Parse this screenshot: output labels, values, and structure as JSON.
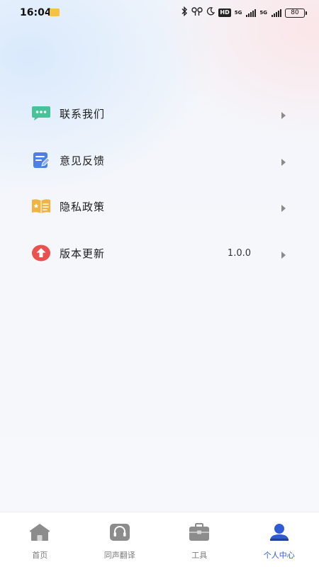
{
  "status_bar": {
    "time": "16:04",
    "hd": "HD",
    "network_1": "5G",
    "network_2": "5G",
    "battery": "80"
  },
  "menu": {
    "items": [
      {
        "label": "联系我们",
        "value": "",
        "icon": "chat-bubble-icon",
        "color": "#47c39a"
      },
      {
        "label": "意见反馈",
        "value": "",
        "icon": "feedback-edit-icon",
        "color": "#4f7fe6"
      },
      {
        "label": "隐私政策",
        "value": "",
        "icon": "privacy-book-icon",
        "color": "#f1b441"
      },
      {
        "label": "版本更新",
        "value": "1.0.0",
        "icon": "upgrade-arrow-icon",
        "color": "#e9524e"
      }
    ]
  },
  "tabbar": {
    "tabs": [
      {
        "label": "首页",
        "icon": "home-icon",
        "active": false
      },
      {
        "label": "同声翻译",
        "icon": "headset-translate-icon",
        "active": false
      },
      {
        "label": "工具",
        "icon": "toolbox-icon",
        "active": false
      },
      {
        "label": "个人中心",
        "icon": "user-profile-icon",
        "active": true
      }
    ],
    "active_color": "#2f5bd6",
    "inactive_color": "#8c8c8c"
  }
}
